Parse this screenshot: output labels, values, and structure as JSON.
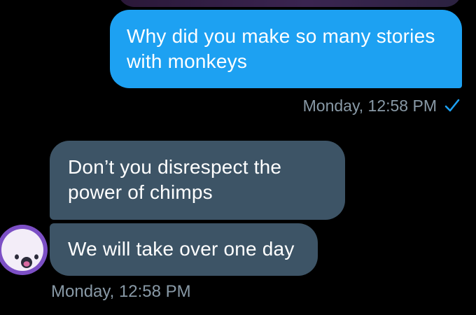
{
  "conversation": {
    "outgoing": {
      "text": "Why did you make so many stories with monkeys",
      "timestamp": "Monday, 12:58 PM",
      "status_icon": "checkmark-icon"
    },
    "incoming": {
      "messages": [
        {
          "text": "Don’t you disrespect the power of chimps"
        },
        {
          "text": "We will take over one day"
        }
      ],
      "timestamp": "Monday, 12:58 PM",
      "avatar_icon": "face-avatar"
    }
  },
  "colors": {
    "background": "#000000",
    "outgoing_bubble": "#1da1f2",
    "incoming_bubble": "#3d5466",
    "meta_text": "#8899a6",
    "check": "#1da1f2",
    "avatar_ring": "#7c4fc5"
  }
}
